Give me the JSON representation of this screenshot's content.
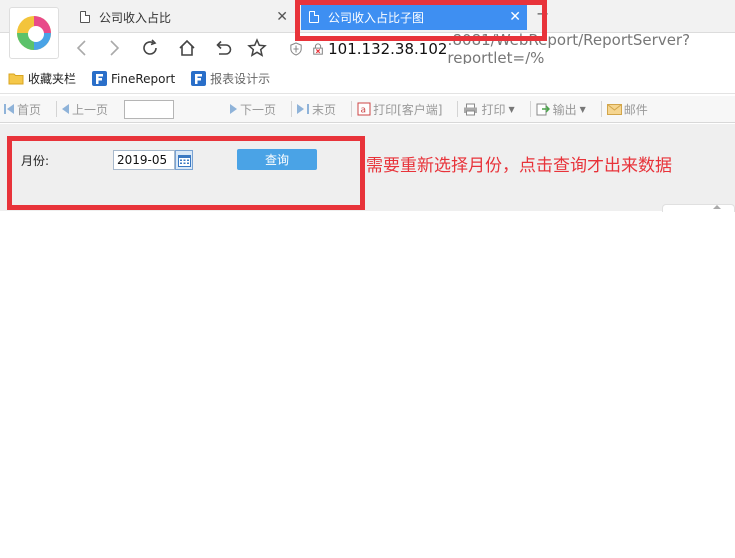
{
  "browser": {
    "tabs": [
      {
        "title": "公司收入占比",
        "active": false
      },
      {
        "title": "公司收入占比子图",
        "active": true
      }
    ],
    "new_tab_label": "−",
    "url": {
      "host": "101.132.38.102",
      "rest": ":8081/WebReport/ReportServer?reportlet=/%"
    },
    "bookmarks": [
      {
        "label": "收藏夹栏",
        "icon": "folder-icon"
      },
      {
        "label": "FineReport",
        "icon": "finereport-icon"
      },
      {
        "label": "报表设计示",
        "icon": "finereport-icon"
      }
    ],
    "accent_color": "#3e8ff2",
    "highlight_color": "#e8333a"
  },
  "report_toolbar": {
    "first_page": "首页",
    "prev_page": "上一页",
    "page_value": "",
    "next_page": "下一页",
    "last_page": "末页",
    "print_client": "打印[客户端]",
    "print": "打印",
    "export": "输出",
    "email": "邮件"
  },
  "params": {
    "month_label": "月份:",
    "month_value": "2019-05",
    "query_button": "查询",
    "query_button_color": "#4aa3e6"
  },
  "annotation": "需要重新选择月份，点击查询才出来数据"
}
